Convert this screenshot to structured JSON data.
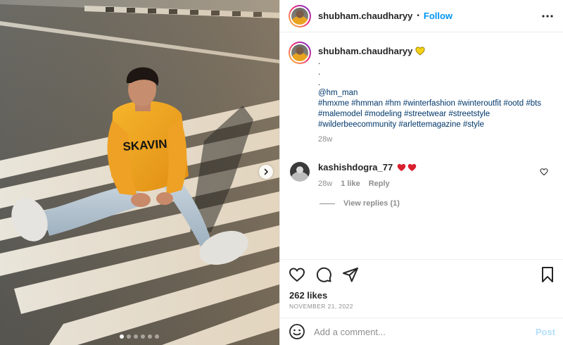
{
  "post": {
    "username": "shubham.chaudharyy",
    "separator": "•",
    "follow_label": "Follow",
    "caption": {
      "username": "shubham.chaudharyy",
      "dot_lines": [
        ".",
        ".",
        "."
      ],
      "mention": "@hm_man",
      "hashtags_line1": "#hmxme #hmman #hm #winterfashion #winteroutfit #ootd #bts",
      "hashtags_line2": "#malemodel #modeling #streetwear #streetstyle",
      "hashtags_line3": "#wilderbeecommunity #arlettemagazine #style",
      "time": "28w"
    },
    "comment": {
      "username": "kashishdogra_77",
      "text": "❤️❤️",
      "time": "28w",
      "likes": "1 like",
      "reply_label": "Reply",
      "view_replies": "View replies (1)"
    },
    "likes": "262 likes",
    "date": "NOVEMBER 21, 2022",
    "add_comment_placeholder": "Add a comment...",
    "post_label": "Post"
  },
  "icons": {
    "more": "more-options-icon",
    "verified_heart": "yellow-heart-emoji",
    "like": "heart-outline-icon",
    "comment": "comment-bubble-icon",
    "share": "paper-plane-icon",
    "save": "bookmark-icon",
    "emoji": "emoji-smiley-icon",
    "next": "chevron-right-icon"
  },
  "carousel": {
    "slide_count": 6,
    "active_index": 0
  },
  "colors": {
    "follow": "#0095f6",
    "post_disabled": "#b2dffc",
    "muted": "#8e8e8e",
    "heart_red": "#ed4956",
    "yellow_heart": "#f5d316"
  }
}
